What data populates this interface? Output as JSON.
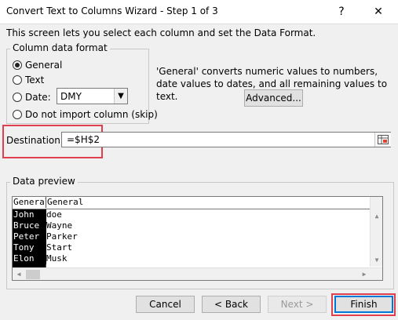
{
  "window": {
    "title": "Convert Text to Columns Wizard - Step 1 of 3",
    "help_glyph": "?",
    "close_glyph": "✕"
  },
  "intro_text": "This screen lets you select each column and set the Data Format.",
  "column_format": {
    "legend": "Column data format",
    "options": [
      {
        "label": "General",
        "mnemonic": "G",
        "selected": true
      },
      {
        "label": "Text",
        "mnemonic": "T",
        "selected": false
      },
      {
        "label": "Date:",
        "mnemonic": "D",
        "selected": false
      },
      {
        "label": "Do not import column (skip)",
        "mnemonic": "i",
        "selected": false
      }
    ],
    "date_format": "DMY"
  },
  "description": "'General' converts numeric values to numbers, date values to dates, and all remaining values to text.",
  "advanced_label": "Advanced...",
  "destination": {
    "label": "Destination:",
    "value": "=$H$2"
  },
  "preview": {
    "legend": "Data preview",
    "header": [
      "General",
      "General"
    ],
    "rows": [
      [
        "John",
        "doe"
      ],
      [
        "Bruce",
        "Wayne"
      ],
      [
        "Peter",
        "Parker"
      ],
      [
        "Tony",
        "Start"
      ],
      [
        "Elon",
        "Musk"
      ]
    ]
  },
  "buttons": {
    "cancel": "Cancel",
    "back": "< Back",
    "next": "Next >",
    "finish": "Finish"
  },
  "colors": {
    "highlight": "#e0404e",
    "default_button_border": "#0078d7"
  }
}
